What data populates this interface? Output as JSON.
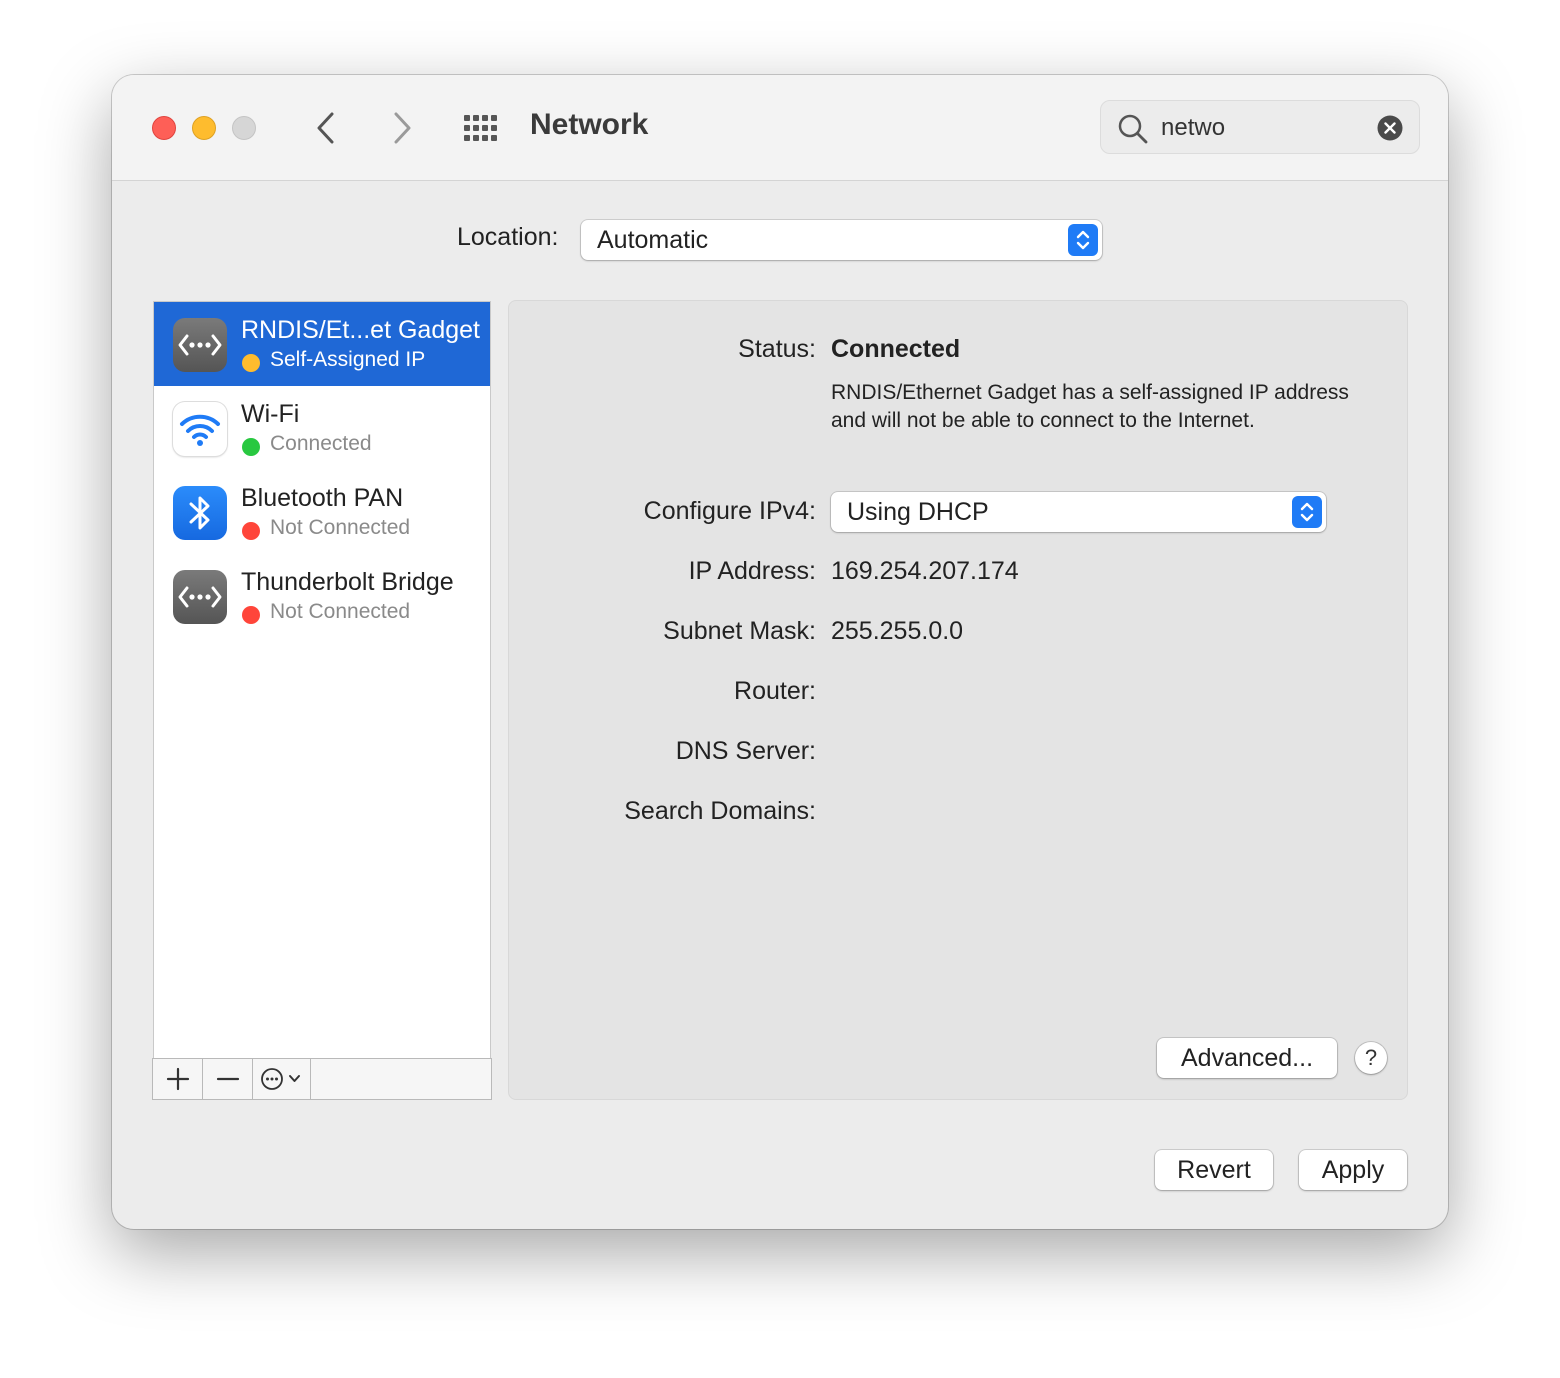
{
  "window": {
    "title": "Network",
    "search": {
      "value": "netwo"
    }
  },
  "location": {
    "label": "Location:",
    "value": "Automatic"
  },
  "services": [
    {
      "name": "RNDIS/Et...et Gadget",
      "status": "Self-Assigned IP",
      "status_color": "#febc2e",
      "icon": "ethernet-icon",
      "selected": true
    },
    {
      "name": "Wi-Fi",
      "status": "Connected",
      "status_color": "#28c840",
      "icon": "wifi-icon",
      "selected": false
    },
    {
      "name": "Bluetooth PAN",
      "status": "Not Connected",
      "status_color": "#ff453a",
      "icon": "bluetooth-icon",
      "selected": false
    },
    {
      "name": "Thunderbolt Bridge",
      "status": "Not Connected",
      "status_color": "#ff453a",
      "icon": "ethernet-icon",
      "selected": false
    }
  ],
  "detail": {
    "status_label": "Status:",
    "status_value": "Connected",
    "status_description": "RNDIS/Ethernet Gadget has a self-assigned IP address and will not be able to connect to the Internet.",
    "configure_label": "Configure IPv4:",
    "configure_value": "Using DHCP",
    "ip_label": "IP Address:",
    "ip_value": "169.254.207.174",
    "subnet_label": "Subnet Mask:",
    "subnet_value": "255.255.0.0",
    "router_label": "Router:",
    "dns_label": "DNS Server:",
    "search_domains_label": "Search Domains:",
    "advanced_label": "Advanced...",
    "help_label": "?"
  },
  "footer": {
    "revert_label": "Revert",
    "apply_label": "Apply"
  },
  "colors": {
    "accent": "#1f68d6",
    "stepper": "#1f7bf6"
  }
}
